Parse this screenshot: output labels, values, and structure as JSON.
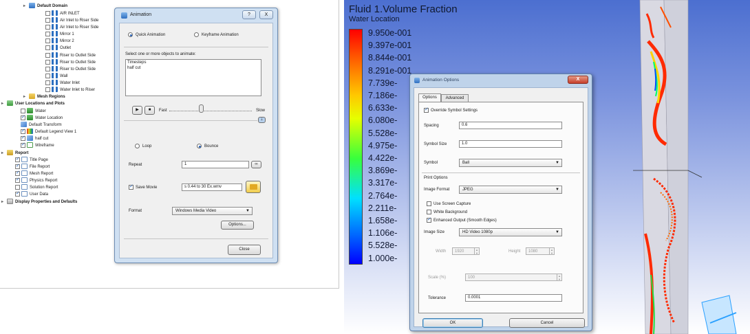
{
  "tree": {
    "rows": [
      {
        "label": "Default Domain",
        "icon": "domain-icon"
      },
      {
        "label": "AIR INLET",
        "icon": "boundary-icon"
      },
      {
        "label": "Air Inlet to Riser Side",
        "icon": "boundary-icon"
      },
      {
        "label": "Air Inlet to Riser Side",
        "icon": "boundary-icon"
      },
      {
        "label": "Mirror 1",
        "icon": "boundary-icon"
      },
      {
        "label": "Mirror 2",
        "icon": "boundary-icon"
      },
      {
        "label": "Outlet",
        "icon": "boundary-icon"
      },
      {
        "label": "Riser to Outlet Side",
        "icon": "boundary-icon"
      },
      {
        "label": "Riser to Outlet Side",
        "icon": "boundary-icon"
      },
      {
        "label": "Riser to Outlet Side",
        "icon": "boundary-icon"
      },
      {
        "label": "Wall",
        "icon": "boundary-icon"
      },
      {
        "label": "Water Inlet",
        "icon": "boundary-icon"
      },
      {
        "label": "Water Inlet to Riser",
        "icon": "boundary-icon"
      },
      {
        "label": "Mesh Regions",
        "icon": "mesh-icon"
      },
      {
        "label": "User Locations and Plots",
        "icon": "user-locations-icon"
      },
      {
        "label": "Water",
        "icon": "location-icon"
      },
      {
        "label": "Water Location",
        "icon": "location-icon"
      },
      {
        "label": "Default Transform",
        "icon": "transform-icon"
      },
      {
        "label": "Default Legend View 1",
        "icon": "legend-icon"
      },
      {
        "label": "half cut",
        "icon": "plane-icon"
      },
      {
        "label": "Wireframe",
        "icon": "wireframe-icon"
      },
      {
        "label": "Report",
        "icon": "report-icon"
      },
      {
        "label": "Title Page",
        "icon": "page-icon"
      },
      {
        "label": "File Report",
        "icon": "page-icon"
      },
      {
        "label": "Mesh Report",
        "icon": "page-icon"
      },
      {
        "label": "Physics Report",
        "icon": "page-icon"
      },
      {
        "label": "Solution Report",
        "icon": "page-icon"
      },
      {
        "label": "User Data",
        "icon": "page-icon"
      },
      {
        "label": "Display Properties and Defaults",
        "icon": "display-icon"
      }
    ]
  },
  "animation_dialog": {
    "title": "Animation",
    "help_btn": "?",
    "close_btn": "X",
    "quick_label": "Quick Animation",
    "keyframe_label": "Keyframe Animation",
    "select_label": "Select one or more objects to animate:",
    "objects": [
      "Timesteps",
      "half cut"
    ],
    "fast_label": "Fast",
    "slow_label": "Slow",
    "loop_label": "Loop",
    "bounce_label": "Bounce",
    "repeat_label": "Repeat",
    "repeat_value": "1",
    "save_movie_label": "Save Movie",
    "save_movie_path": "s 0.44 to 30 Ex.wmv",
    "format_label": "Format",
    "format_value": "Windows Media Video",
    "options_btn": "Options...",
    "close_label": "Close"
  },
  "viewer": {
    "legend_title": "Fluid 1.Volume Fraction",
    "legend_subtitle": "Water Location",
    "ticks": [
      "9.950e-001",
      "9.397e-001",
      "8.844e-001",
      "8.291e-001",
      "7.739e-",
      "7.186e-",
      "6.633e-",
      "6.080e-",
      "5.528e-",
      "4.975e-",
      "4.422e-",
      "3.869e-",
      "3.317e-",
      "2.764e-",
      "2.211e-",
      "1.658e-",
      "1.106e-",
      "5.528e-",
      "1.000e-"
    ],
    "legend_colors": [
      "#ff0000",
      "#ffc800",
      "#38ff3c",
      "#00e0ff",
      "#0000ff"
    ]
  },
  "options_dialog": {
    "title": "Animation Options",
    "close_btn": "X",
    "tab_options": "Options",
    "tab_advanced": "Advanced",
    "override_label": "Override Symbol Settings",
    "spacing_label": "Spacing",
    "spacing_value": "0.6",
    "symbol_size_label": "Symbol Size",
    "symbol_size_value": "1.0",
    "symbol_label": "Symbol",
    "symbol_value": "Ball",
    "print_options_label": "Print Options",
    "image_format_label": "Image Format",
    "image_format_value": "JPEG",
    "use_screen_capture_label": "Use Screen Capture",
    "white_background_label": "White Background",
    "enhanced_output_label": "Enhanced Output (Smooth Edges)",
    "image_size_label": "Image Size",
    "image_size_value": "HD Video 1080p",
    "width_label": "Width",
    "width_value": "1920",
    "height_label": "Height",
    "height_value": "1080",
    "scale_label": "Scale (%)",
    "scale_value": "100",
    "tolerance_label": "Tolerance",
    "tolerance_value": "0.0001",
    "ok_label": "OK",
    "cancel_label": "Cancel"
  }
}
